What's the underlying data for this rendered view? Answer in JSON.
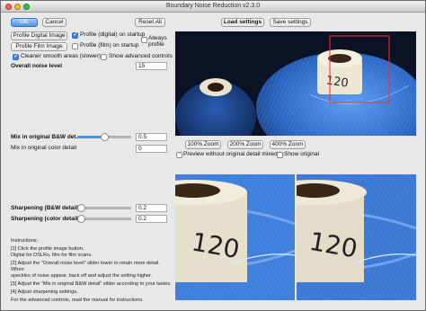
{
  "window": {
    "title": "Boundary Noise Reduction v2.3.0"
  },
  "buttons": {
    "ok": "OK",
    "cancel": "Cancel",
    "reset_all": "Reset All",
    "load_settings": "Load settings",
    "save_settings": "Save settings",
    "profile_digital": "Profile Digital Image",
    "profile_film": "Profile Film Image",
    "zoom_100": "100% Zoom",
    "zoom_200": "200% Zoom",
    "zoom_400": "400% Zoom"
  },
  "checkboxes": {
    "profile_digital_startup": {
      "label": "Profile (digital) on startup",
      "checked": true
    },
    "profile_film_startup": {
      "label": "Profile (film) on startup",
      "checked": false
    },
    "always_profile": {
      "label": "Always profile",
      "checked": false
    },
    "cleaner_smooth": {
      "label": "Cleaner smooth areas (slower)",
      "checked": true
    },
    "show_advanced": {
      "label": "Show advanced controls",
      "checked": false
    },
    "preview_without_detail": {
      "label": "Preview without original detail mixed in",
      "checked": false
    },
    "show_original": {
      "label": "Show original",
      "checked": false
    }
  },
  "controls": {
    "overall_noise": {
      "label": "Overall noise level",
      "value": "15",
      "level": 0.55
    },
    "mix_bw": {
      "label": "Mix in original B&W det.",
      "value": "0.5",
      "level": 0.5
    },
    "mix_color": {
      "label": "Mix in original color detail",
      "value": "0",
      "level": 0.0
    },
    "sharpen_bw": {
      "label": "Sharpening (B&W detail)",
      "value": "0.2",
      "level": 0.07
    },
    "sharpen_color": {
      "label": "Sharpening (color detail)",
      "value": "0.2",
      "level": 0.07
    }
  },
  "instructions": {
    "heading": "Instructions:",
    "step1": "[1] Click the profile image button.",
    "step1b": "Digital for DSLRs, film for film scans.",
    "step2": "[2] Adjust the \"Overall noise level\" slider lower to retain more detail.  When",
    "step2b": "speckles of noise appear, back off and adjust the setting higher.",
    "step3": "[3] Adjust the \"Mix in original B&W detail\" slider according to your tastes.",
    "step4": "[4] Adjust sharpening settings.",
    "step5": "For the advanced controls, read the manual for instructions."
  },
  "preview": {
    "overview_labels": [
      "120",
      "120"
    ],
    "zoom_labels_left": "120",
    "zoom_labels_right": "120",
    "colors": {
      "thread": "#2f6fcf",
      "highlight": "#7fb0ff",
      "selection": "#ff2a2a",
      "bg": "#0b1322"
    }
  }
}
